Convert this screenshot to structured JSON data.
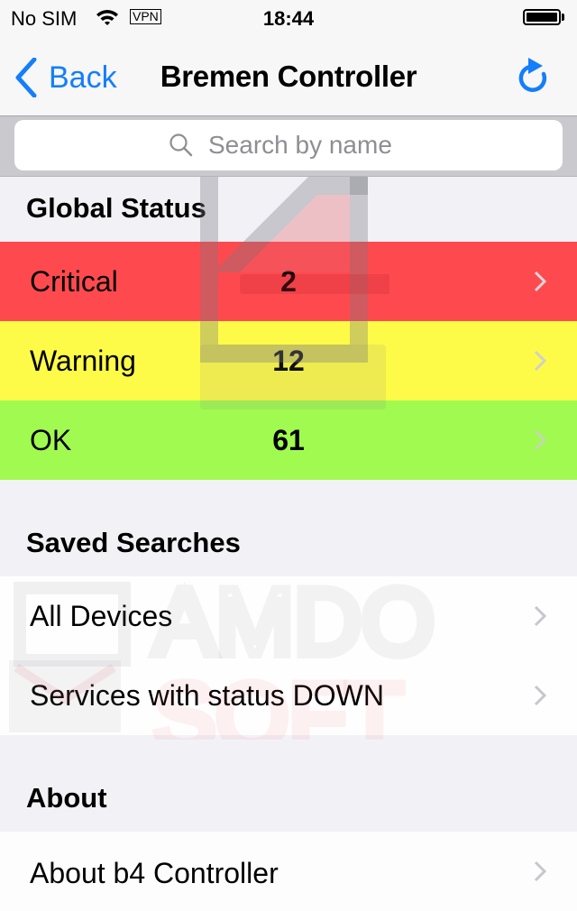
{
  "status_bar": {
    "carrier": "No SIM",
    "wifi_icon": "wifi-icon",
    "vpn_label": "VPN",
    "time": "18:44",
    "battery_icon": "battery-full-icon"
  },
  "nav": {
    "back_label": "Back",
    "title": "Bremen Controller",
    "refresh_icon": "refresh-icon"
  },
  "search": {
    "placeholder": "Search by name",
    "value": ""
  },
  "sections": {
    "global_status": {
      "header": "Global Status",
      "rows": [
        {
          "label": "Critical",
          "count": "2",
          "color": "#fe4a4f"
        },
        {
          "label": "Warning",
          "count": "12",
          "color": "#fdfb48"
        },
        {
          "label": "OK",
          "count": "61",
          "color": "#a1fa50"
        }
      ]
    },
    "saved_searches": {
      "header": "Saved Searches",
      "rows": [
        {
          "label": "All Devices"
        },
        {
          "label": "Services with status DOWN"
        }
      ]
    },
    "about": {
      "header": "About",
      "rows": [
        {
          "label": "About b4 Controller"
        }
      ]
    }
  },
  "watermark": {
    "line1": "AMDO",
    "line2": "SOFT"
  },
  "colors": {
    "accent": "#147efb",
    "chevron": "#c7c7cc",
    "background": "#f2f2f6"
  }
}
